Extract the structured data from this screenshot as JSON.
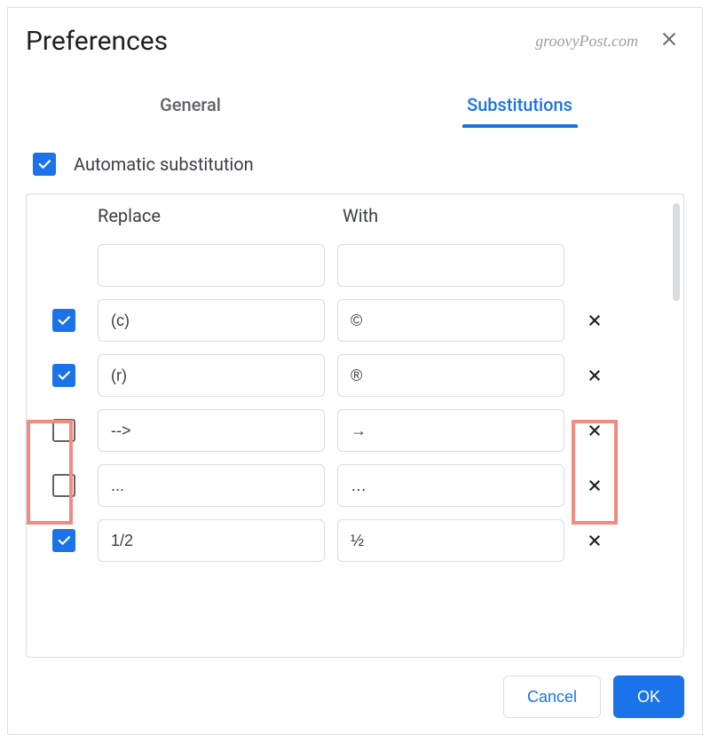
{
  "title": "Preferences",
  "watermark": "groovyPost.com",
  "tabs": {
    "general": "General",
    "substitutions": "Substitutions"
  },
  "auto_sub": {
    "label": "Automatic substitution",
    "checked": true
  },
  "headers": {
    "replace": "Replace",
    "with": "With"
  },
  "rows": [
    {
      "checked": null,
      "replace": "",
      "with": "",
      "deletable": false
    },
    {
      "checked": true,
      "replace": "(c)",
      "with": "©",
      "deletable": true
    },
    {
      "checked": true,
      "replace": "(r)",
      "with": "®",
      "deletable": true
    },
    {
      "checked": false,
      "replace": "-->",
      "with": "→",
      "deletable": true
    },
    {
      "checked": false,
      "replace": "...",
      "with": "…",
      "deletable": true
    },
    {
      "checked": true,
      "replace": "1/2",
      "with": "½",
      "deletable": true
    }
  ],
  "buttons": {
    "cancel": "Cancel",
    "ok": "OK"
  },
  "colors": {
    "accent": "#1a73e8",
    "highlight": "#f28b82"
  }
}
